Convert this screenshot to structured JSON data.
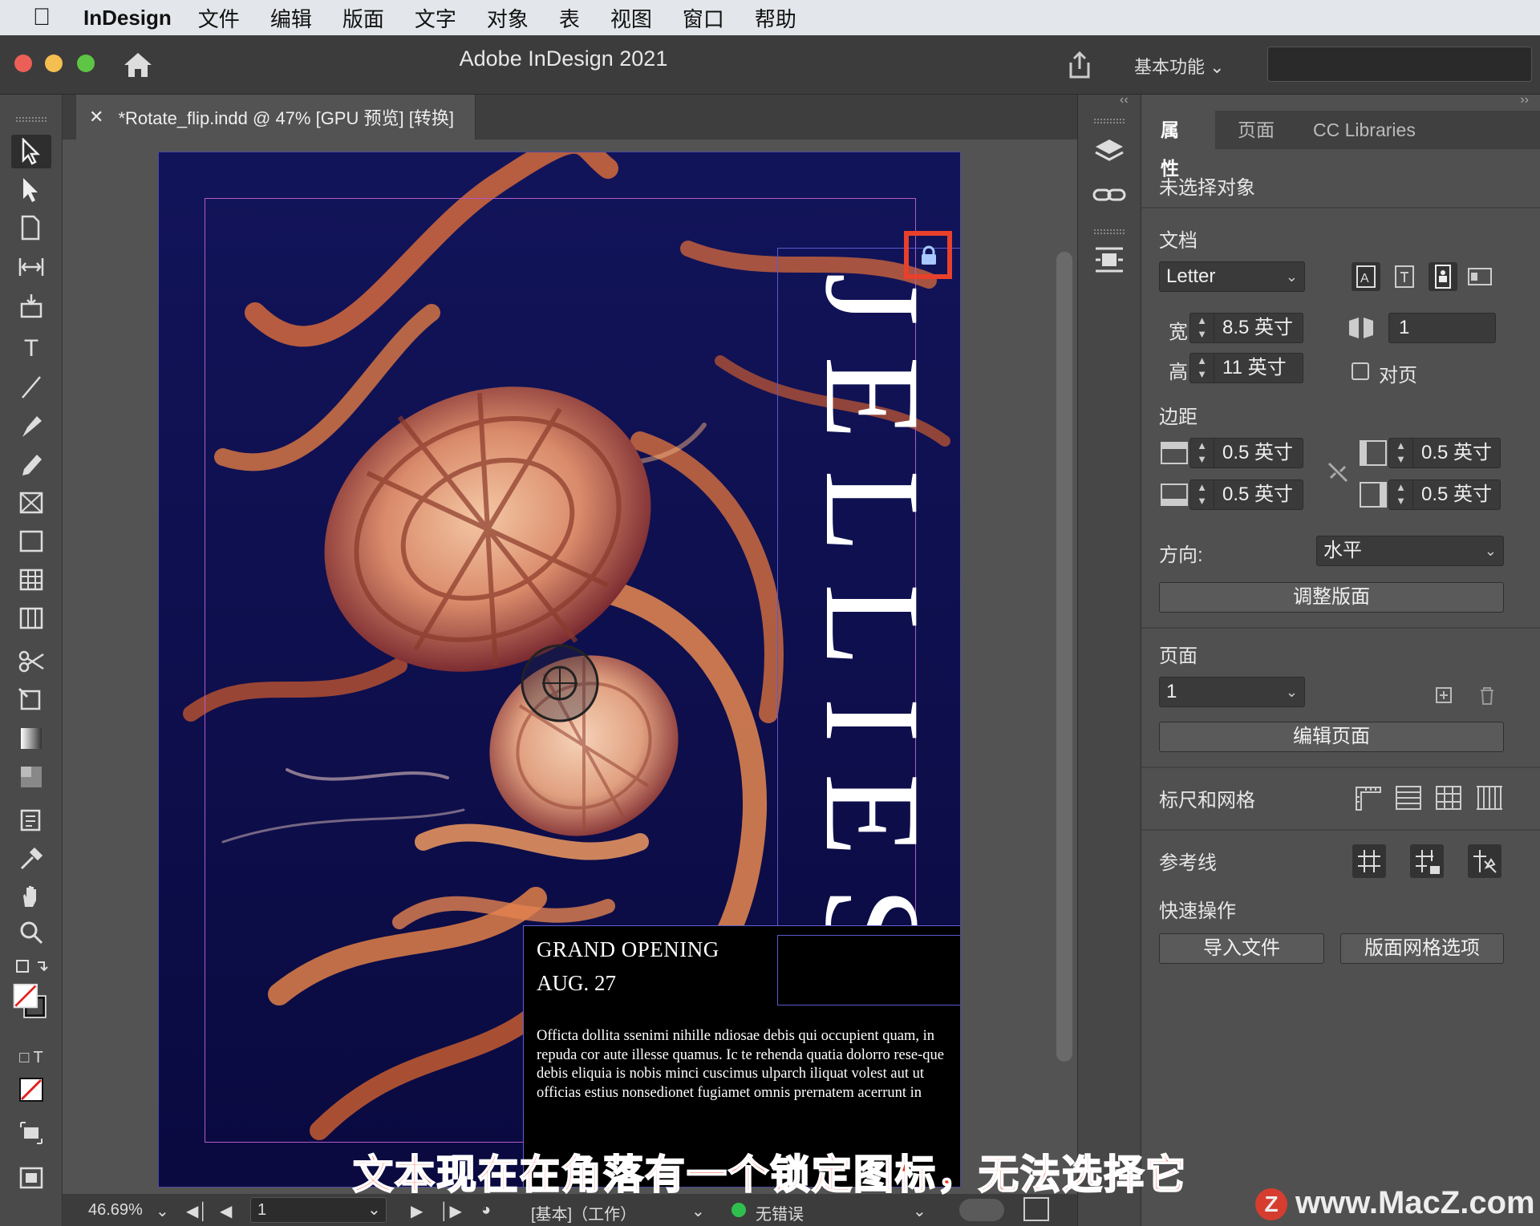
{
  "menubar": {
    "app": "InDesign",
    "items": [
      "文件",
      "编辑",
      "版面",
      "文字",
      "对象",
      "表",
      "视图",
      "窗口",
      "帮助"
    ]
  },
  "titlebar": {
    "title": "Adobe InDesign 2021",
    "workspace": "基本功能"
  },
  "document": {
    "tab_title": "*Rotate_flip.indd @ 47% [GPU 预览] [转换]",
    "headline": "JELLIES",
    "event_line1": "GRAND OPENING",
    "event_line2": "AUG. 27",
    "body_text": "Officta dollita ssenimi nihille ndiosae debis qui occupient quam, in repuda cor aute illesse quamus. Ic te rehenda quatia dolorro rese-que debis eliquia is nobis minci cuscimus ulparch iliquat volest aut ut officias estius nonsedionet fugiamet omnis prernatem acerrunt in"
  },
  "statusbar": {
    "zoom": "46.69%",
    "page": "1",
    "profile": "[基本]（工作）",
    "preflight": "无错误"
  },
  "panel": {
    "tabs": [
      "属性",
      "页面",
      "CC Libraries"
    ],
    "no_selection": "未选择对象",
    "doc_section": "文档",
    "page_size": "Letter",
    "width_label": "宽",
    "width_value": "8.5 英寸",
    "height_label": "高",
    "height_value": "11 英寸",
    "pages_count": "1",
    "facing_pages": "对页",
    "margins_section": "边距",
    "margin_top": "0.5 英寸",
    "margin_bottom": "0.5 英寸",
    "margin_left": "0.5 英寸",
    "margin_right": "0.5 英寸",
    "orientation_label": "方向:",
    "orientation_value": "水平",
    "adjust_layout": "调整版面",
    "page_section": "页面",
    "current_page": "1",
    "edit_page": "编辑页面",
    "rulers_grids": "标尺和网格",
    "guides": "参考线",
    "quick_actions": "快速操作",
    "import_file": "导入文件",
    "layout_grid_options": "版面网格选项"
  },
  "overlay": {
    "subtitle": "文本现在在角落有一个锁定图标，无法选择它",
    "watermark": "www.MacZ.com",
    "watermark_logo": "Z"
  },
  "colors": {
    "lock_highlight": "#e8402a",
    "page_bg": "#0c0c4a"
  }
}
